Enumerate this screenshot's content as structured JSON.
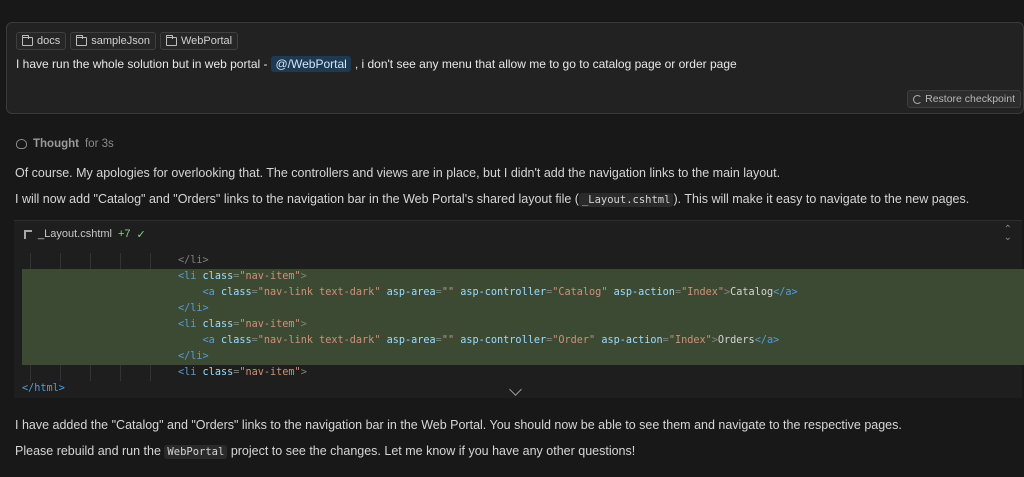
{
  "user_message": {
    "context_chips": [
      "docs",
      "sampleJson",
      "WebPortal"
    ],
    "text_before": "I have run the whole solution but in web portal -",
    "mention": "@/WebPortal",
    "text_after": ", i don't see any menu that allow me to go to catalog page or order page",
    "restore_label": "Restore checkpoint"
  },
  "thought": {
    "label": "Thought",
    "duration": "for 3s"
  },
  "response": {
    "p1": "Of course. My apologies for overlooking that. The controllers and views are in place, but I didn't add the navigation links to the main layout.",
    "p2_before": "I will now add \"Catalog\" and \"Orders\" links to the navigation bar in the Web Portal's shared layout file (",
    "p2_code": "_Layout.cshtml",
    "p2_after": "). This will make it easy to navigate to the new pages.",
    "p3": "I have added the \"Catalog\" and \"Orders\" links to the navigation bar in the Web Portal. You should now be able to see them and navigate to the respective pages.",
    "p4_before": "Please rebuild and run the",
    "p4_code": "WebPortal",
    "p4_after": "project to see the changes. Let me know if you have any other questions!"
  },
  "code_block": {
    "file_name": "_Layout.cshtml",
    "diff_count": "+7",
    "lines": {
      "l1_close": "</li>",
      "l2_open": "<li",
      "l2_attr": "class",
      "l2_val": "\"nav-item\"",
      "l3_open": "<a",
      "l3_a1": "class",
      "l3_v1": "\"nav-link text-dark\"",
      "l3_a2": "asp-area",
      "l3_v2": "\"\"",
      "l3_a3": "asp-controller",
      "l3_v3": "\"Catalog\"",
      "l3_a4": "asp-action",
      "l3_v4": "\"Index\"",
      "l3_text": "Catalog",
      "l3_close": "</a>",
      "l4_close": "</li>",
      "l5_open": "<li",
      "l5_attr": "class",
      "l5_val": "\"nav-item\"",
      "l6_open": "<a",
      "l6_a1": "class",
      "l6_v1": "\"nav-link text-dark\"",
      "l6_a2": "asp-area",
      "l6_v2": "\"\"",
      "l6_a3": "asp-controller",
      "l6_v3": "\"Order\"",
      "l6_a4": "asp-action",
      "l6_v4": "\"Index\"",
      "l6_text": "Orders",
      "l6_close": "</a>",
      "l7_close": "</li>",
      "l8_open": "<li",
      "l8_attr": "class",
      "l8_val": "\"nav-item\"",
      "l9_close": "</html>"
    }
  }
}
